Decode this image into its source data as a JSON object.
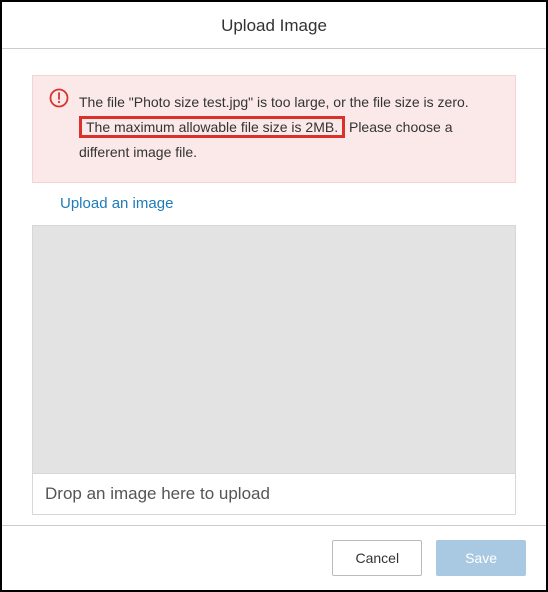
{
  "header": {
    "title": "Upload Image"
  },
  "error": {
    "line1": "The file \"Photo size test.jpg\" is too large, or the file size is zero.",
    "line2_highlight": "The maximum allowable file size is 2MB.",
    "line2_rest": " Please choose a different image file."
  },
  "upload": {
    "link_label": "Upload an image",
    "dropzone_label": "Drop an image here to upload"
  },
  "footer": {
    "cancel_label": "Cancel",
    "save_label": "Save"
  },
  "colors": {
    "error_bg": "#fbe9e9",
    "highlight_border": "#d9322d",
    "link": "#1E7BB8",
    "save_bg": "#a9c9e2"
  }
}
